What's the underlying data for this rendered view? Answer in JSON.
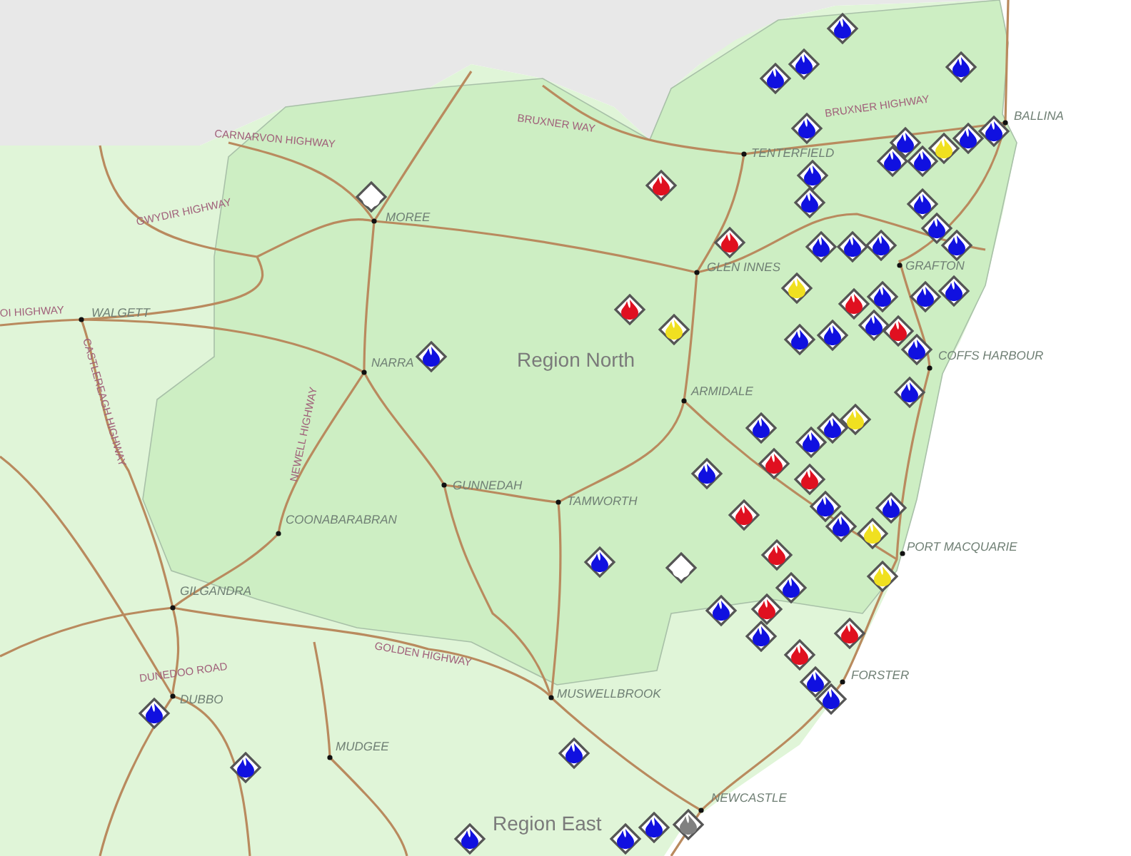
{
  "map": {
    "regions": [
      {
        "label": "Region North"
      },
      {
        "label": "Region East"
      }
    ],
    "towns": [
      {
        "label": "BALLINA"
      },
      {
        "label": "TENTERFIELD"
      },
      {
        "label": "MOREE"
      },
      {
        "label": "GRAFTON"
      },
      {
        "label": "GLEN INNES"
      },
      {
        "label": "WALGETT"
      },
      {
        "label": "COFFS HARBOUR"
      },
      {
        "label": "NARRA"
      },
      {
        "label": "ARMIDALE"
      },
      {
        "label": "GUNNEDAH"
      },
      {
        "label": "TAMWORTH"
      },
      {
        "label": "COONABARABRAN"
      },
      {
        "label": "PORT MACQUARIE"
      },
      {
        "label": "GILGANDRA"
      },
      {
        "label": "FORSTER"
      },
      {
        "label": "MUSWELLBROOK"
      },
      {
        "label": "DUBBO"
      },
      {
        "label": "MUDGEE"
      },
      {
        "label": "NEWCASTLE"
      }
    ],
    "highways": [
      {
        "label": "BRUXNER HIGHWAY"
      },
      {
        "label": "BRUXNER WAY"
      },
      {
        "label": "CARNARVON HIGHWAY"
      },
      {
        "label": "GWYDIR HIGHWAY"
      },
      {
        "label": "OI HIGHWAY"
      },
      {
        "label": "CASTLEREAGH HIGHWAY"
      },
      {
        "label": "NEWELL HIGHWAY"
      },
      {
        "label": "GOLDEN HIGHWAY"
      },
      {
        "label": "DUNEDOO ROAD"
      }
    ],
    "markers": [
      {
        "color": "#1010e0"
      },
      {
        "color": "#1010e0"
      },
      {
        "color": "#1010e0"
      },
      {
        "color": "#1010e0"
      },
      {
        "color": "#1010e0"
      },
      {
        "color": "#1010e0"
      },
      {
        "color": "#1010e0"
      },
      {
        "color": "#1010e0"
      },
      {
        "color": "#1010e0"
      },
      {
        "color": "#1010e0"
      },
      {
        "color": "#1010e0"
      },
      {
        "color": "#1010e0"
      },
      {
        "color": "#1010e0"
      },
      {
        "color": "#1010e0"
      },
      {
        "color": "#1010e0"
      },
      {
        "color": "#1010e0"
      },
      {
        "color": "#1010e0"
      },
      {
        "color": "#1010e0"
      },
      {
        "color": "#1010e0"
      },
      {
        "color": "#1010e0"
      },
      {
        "color": "#1010e0"
      },
      {
        "color": "#1010e0"
      },
      {
        "color": "#1010e0"
      },
      {
        "color": "#1010e0"
      },
      {
        "color": "#1010e0"
      },
      {
        "color": "#1010e0"
      },
      {
        "color": "#1010e0"
      },
      {
        "color": "#1010e0"
      },
      {
        "color": "#1010e0"
      },
      {
        "color": "#1010e0"
      },
      {
        "color": "#1010e0"
      },
      {
        "color": "#1010e0"
      },
      {
        "color": "#1010e0"
      },
      {
        "color": "#1010e0"
      },
      {
        "color": "#1010e0"
      },
      {
        "color": "#1010e0"
      },
      {
        "color": "#1010e0"
      },
      {
        "color": "#1010e0"
      },
      {
        "color": "#1010e0"
      },
      {
        "color": "#1010e0"
      },
      {
        "color": "#1010e0"
      },
      {
        "color": "#1010e0"
      },
      {
        "color": "#1010e0"
      },
      {
        "color": "#1010e0"
      },
      {
        "color": "#1010e0"
      },
      {
        "color": "#1010e0"
      },
      {
        "color": "#e01020"
      },
      {
        "color": "#e01020"
      },
      {
        "color": "#e01020"
      },
      {
        "color": "#e01020"
      },
      {
        "color": "#e01020"
      },
      {
        "color": "#e01020"
      },
      {
        "color": "#e01020"
      },
      {
        "color": "#e01020"
      },
      {
        "color": "#e01020"
      },
      {
        "color": "#e01020"
      },
      {
        "color": "#e01020"
      },
      {
        "color": "#e01020"
      },
      {
        "color": "#f0e020"
      },
      {
        "color": "#f0e020"
      },
      {
        "color": "#f0e020"
      },
      {
        "color": "#f0e020"
      },
      {
        "color": "#f0e020"
      },
      {
        "color": "#f0e020"
      },
      {
        "color": "#ffffff"
      },
      {
        "color": "#ffffff"
      },
      {
        "color": "#808080"
      }
    ]
  }
}
